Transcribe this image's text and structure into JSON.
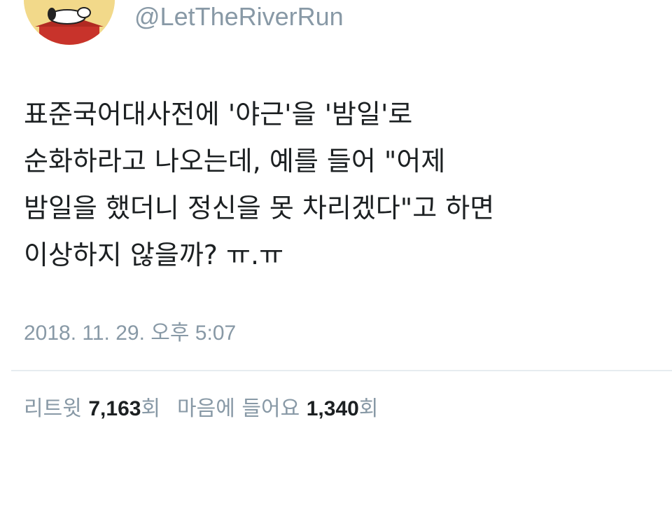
{
  "tweet": {
    "handle": "@LetTheRiverRun",
    "lines": [
      "표준국어대사전에 '야근'을 '밤일'로",
      "순화하라고 나오는데, 예를 들어 \"어제",
      "밤일을 했더니 정신을 못 차리겠다\"고 하면",
      "이상하지 않을까? ㅠ.ㅠ"
    ],
    "timestamp": "2018. 11. 29. 오후 5:07"
  },
  "stats": {
    "retweet_label": "리트윗",
    "retweet_count": "7,163",
    "retweet_unit": "회",
    "like_label": "마음에 들어요",
    "like_count": "1,340",
    "like_unit": "회"
  },
  "colors": {
    "text": "#1c2022",
    "muted": "#8899a6",
    "divider": "#e6ecf0"
  }
}
